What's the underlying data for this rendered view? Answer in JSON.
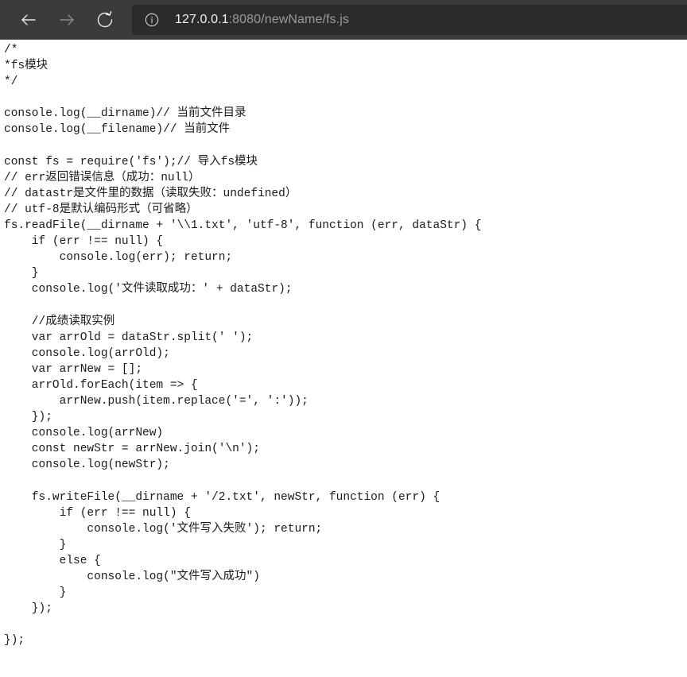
{
  "browser": {
    "back_icon": "arrow-left-icon",
    "forward_icon": "arrow-right-icon",
    "reload_icon": "reload-icon",
    "site_info_icon": "info-circle-icon",
    "url_host": "127.0.0.1",
    "url_rest": ":8080/newName/fs.js",
    "url_full": "127.0.0.1:8080/newName/fs.js",
    "toolbar_bg": "#3b3b3b",
    "urlbar_bg": "#2b2b2b",
    "host_color": "#f2f2f2",
    "path_color": "#9b9b9b"
  },
  "document": {
    "content_type": "plain-text-javascript-source",
    "text_color": "#1a1a1a",
    "background": "#ffffff",
    "source": "/*\n*fs模块\n*/\n\nconsole.log(__dirname)// 当前文件目录\nconsole.log(__filename)// 当前文件\n\nconst fs = require('fs');// 导入fs模块\n// err返回错误信息（成功：null）\n// datastr是文件里的数据（读取失败：undefined）\n// utf-8是默认编码形式（可省略）\nfs.readFile(__dirname + '\\\\1.txt', 'utf-8', function (err, dataStr) {\n    if (err !== null) {\n        console.log(err); return;\n    }\n    console.log('文件读取成功：' + dataStr);\n\n    //成绩读取实例\n    var arrOld = dataStr.split(' ');\n    console.log(arrOld);\n    var arrNew = [];\n    arrOld.forEach(item => {\n        arrNew.push(item.replace('=', ':'));\n    });\n    console.log(arrNew)\n    const newStr = arrNew.join('\\n');\n    console.log(newStr);\n\n    fs.writeFile(__dirname + '/2.txt', newStr, function (err) {\n        if (err !== null) {\n            console.log('文件写入失败'); return;\n        }\n        else {\n            console.log(\"文件写入成功\")\n        }\n    });\n\n});"
  }
}
